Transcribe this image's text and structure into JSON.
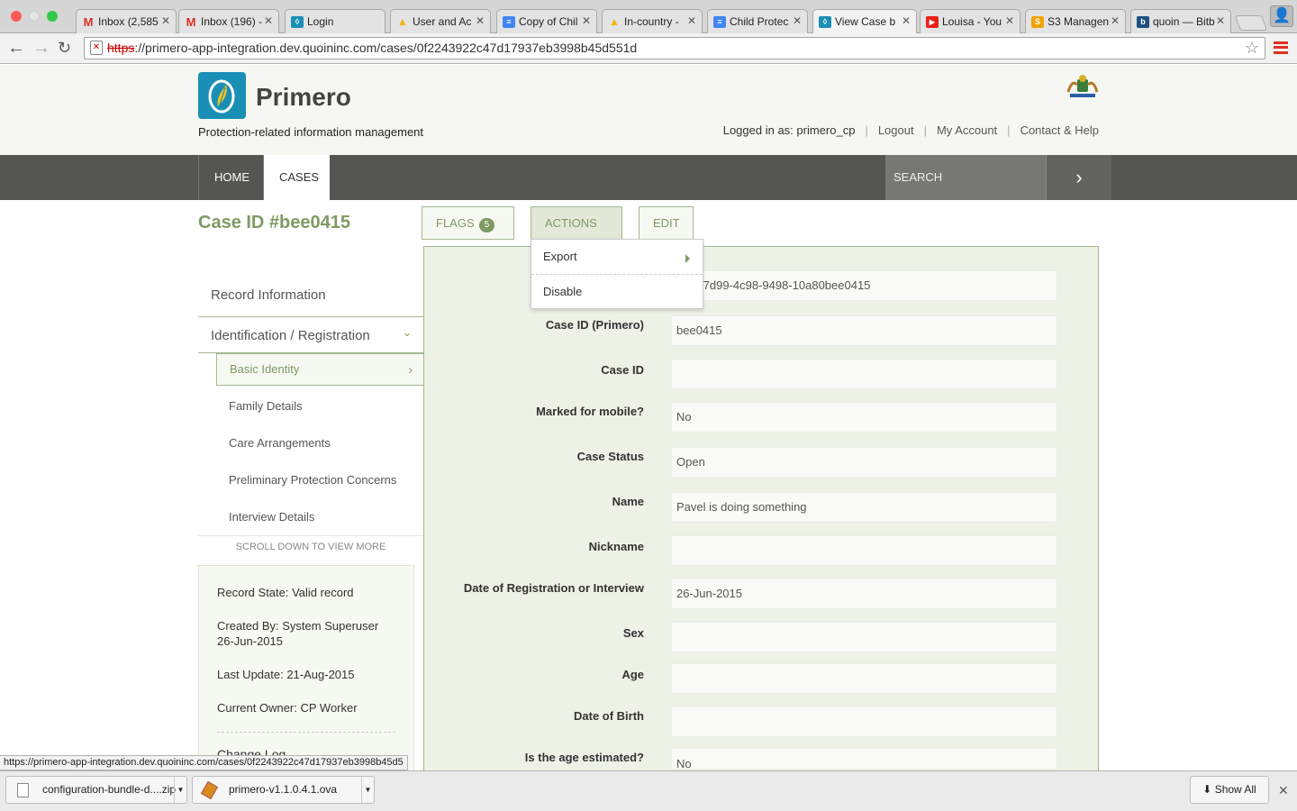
{
  "browser": {
    "tabs": [
      {
        "label": "Inbox (2,585",
        "icon": "gmail-icon",
        "color": "#d93025"
      },
      {
        "label": "Inbox (196) -",
        "icon": "gmail-icon",
        "color": "#d93025"
      },
      {
        "label": "Login",
        "icon": "primero-icon",
        "color": "#1a8fb6"
      },
      {
        "label": "User and Ac",
        "icon": "drive-icon",
        "color": "#f4b400"
      },
      {
        "label": "Copy of Chil",
        "icon": "docs-icon",
        "color": "#4285f4"
      },
      {
        "label": "In-country -",
        "icon": "drive-icon",
        "color": "#f4b400"
      },
      {
        "label": "Child Protec",
        "icon": "docs-icon",
        "color": "#4285f4"
      },
      {
        "label": "View Case b",
        "icon": "primero-icon",
        "color": "#1a8fb6",
        "active": true
      },
      {
        "label": "Louisa - You",
        "icon": "youtube-icon",
        "color": "#e62117"
      },
      {
        "label": "S3 Managen",
        "icon": "aws-icon",
        "color": "#f0a30a"
      },
      {
        "label": "quoin — Bitb",
        "icon": "bitbucket-icon",
        "color": "#205081"
      }
    ],
    "url_scheme": "https",
    "url_rest": "://primero-app-integration.dev.quoininc.com/cases/0f2243922c47d17937eb3998b45d551d",
    "status_url": "https://primero-app-integration.dev.quoininc.com/cases/0f2243922c47d17937eb3998b45d5",
    "downloads": [
      {
        "name": "configuration-bundle-d....zip"
      },
      {
        "name": "primero-v1.1.0.4.1.ova"
      }
    ],
    "show_all": "Show All"
  },
  "header": {
    "app_name": "Primero",
    "tagline": "Protection-related information management",
    "logged_in": "Logged in as: primero_cp",
    "logout": "Logout",
    "my_account": "My Account",
    "contact": "Contact & Help"
  },
  "nav": {
    "home": "HOME",
    "cases": "CASES",
    "search_placeholder": "SEARCH"
  },
  "case": {
    "title": "Case ID #bee0415",
    "flags_label": "FLAGS",
    "flags_count": "5",
    "actions_label": "ACTIONS",
    "edit_label": "EDIT",
    "actions_menu": [
      "Export",
      "Disable"
    ]
  },
  "sidebar": {
    "record_information": "Record Information",
    "identification": "Identification / Registration",
    "items": [
      "Basic Identity",
      "Family Details",
      "Care Arrangements",
      "Preliminary Protection Concerns",
      "Interview Details"
    ],
    "scroll_more": "SCROLL DOWN TO VIEW MORE",
    "record_state": "Record State: Valid record",
    "created_by": "Created By: System Superuser",
    "created_date": "26-Jun-2015",
    "last_update": "Last Update: 21-Aug-2015",
    "current_owner": "Current Owner: CP Worker",
    "change_log": "Change Log"
  },
  "form": {
    "fields": [
      {
        "label": "",
        "value": "f714-7d99-4c98-9498-10a80bee0415"
      },
      {
        "label": "Case ID (Primero)",
        "value": "bee0415"
      },
      {
        "label": "Case ID",
        "value": ""
      },
      {
        "label": "Marked for mobile?",
        "value": "No"
      },
      {
        "label": "Case Status",
        "value": "Open"
      },
      {
        "label": "Name",
        "value": "Pavel is doing something"
      },
      {
        "label": "Nickname",
        "value": ""
      },
      {
        "label": "Date of Registration or Interview",
        "value": "26-Jun-2015"
      },
      {
        "label": "Sex",
        "value": ""
      },
      {
        "label": "Age",
        "value": ""
      },
      {
        "label": "Date of Birth",
        "value": ""
      },
      {
        "label": "Is the age estimated?",
        "value": "No"
      }
    ]
  }
}
